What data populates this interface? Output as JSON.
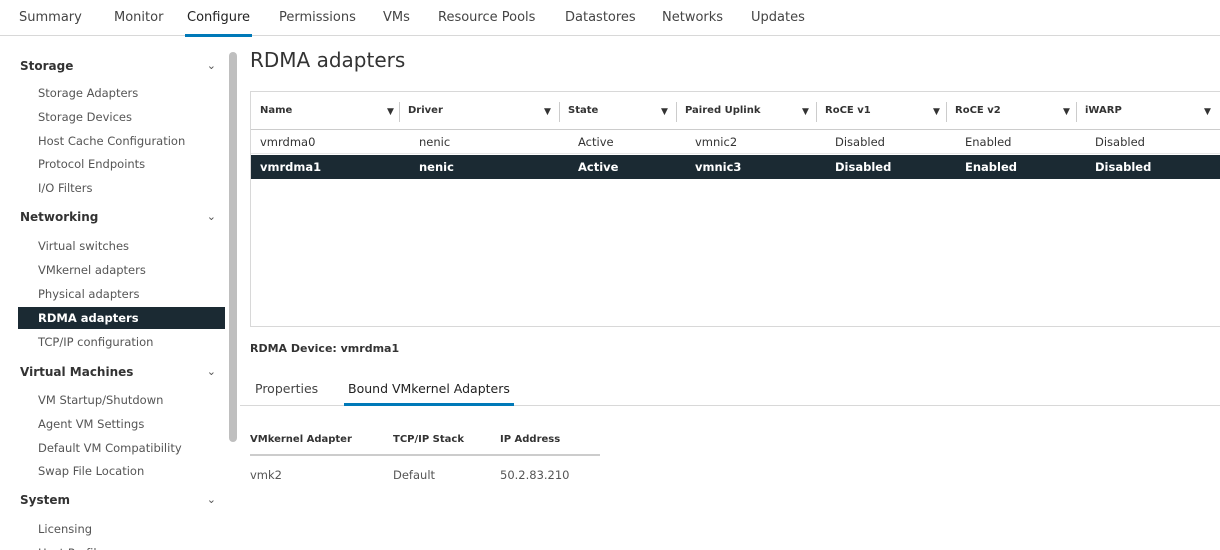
{
  "top_tabs": [
    {
      "label": "Summary"
    },
    {
      "label": "Monitor"
    },
    {
      "label": "Configure",
      "active": true
    },
    {
      "label": "Permissions"
    },
    {
      "label": "VMs"
    },
    {
      "label": "Resource Pools"
    },
    {
      "label": "Datastores"
    },
    {
      "label": "Networks"
    },
    {
      "label": "Updates"
    }
  ],
  "sidebar": {
    "storage": {
      "title": "Storage",
      "items": [
        "Storage Adapters",
        "Storage Devices",
        "Host Cache Configuration",
        "Protocol Endpoints",
        "I/O Filters"
      ]
    },
    "networking": {
      "title": "Networking",
      "items": [
        "Virtual switches",
        "VMkernel adapters",
        "Physical adapters",
        "RDMA adapters",
        "TCP/IP configuration"
      ]
    },
    "virtual_machines": {
      "title": "Virtual Machines",
      "items": [
        "VM Startup/Shutdown",
        "Agent VM Settings",
        "Default VM Compatibility",
        "Swap File Location"
      ]
    },
    "system": {
      "title": "System",
      "items": [
        "Licensing",
        "Host Profile"
      ]
    },
    "selected_item": "RDMA adapters"
  },
  "icons": {
    "chevron": "chevron-down-icon",
    "filter": "filter-icon"
  },
  "main": {
    "title": "RDMA adapters",
    "grid": {
      "columns": [
        "Name",
        "Driver",
        "State",
        "Paired Uplink",
        "RoCE v1",
        "RoCE v2",
        "iWARP"
      ],
      "rows": [
        [
          "vmrdma0",
          "nenic",
          "Active",
          "vmnic2",
          "Disabled",
          "Enabled",
          "Disabled"
        ],
        [
          "vmrdma1",
          "nenic",
          "Active",
          "vmnic3",
          "Disabled",
          "Enabled",
          "Disabled"
        ]
      ],
      "selected_row": 1
    },
    "device_label": "RDMA Device: vmrdma1",
    "subtabs": [
      "Properties",
      "Bound VMkernel Adapters"
    ],
    "active_subtab": 1,
    "bound_table": {
      "columns": [
        "VMkernel Adapter",
        "TCP/IP Stack",
        "IP Address"
      ],
      "rows": [
        [
          "vmk2",
          "Default",
          "50.2.83.210"
        ]
      ]
    }
  },
  "colors": {
    "accent": "#0079b8",
    "selected_bg": "#1b2a33",
    "selected_text": "#ffffff"
  }
}
